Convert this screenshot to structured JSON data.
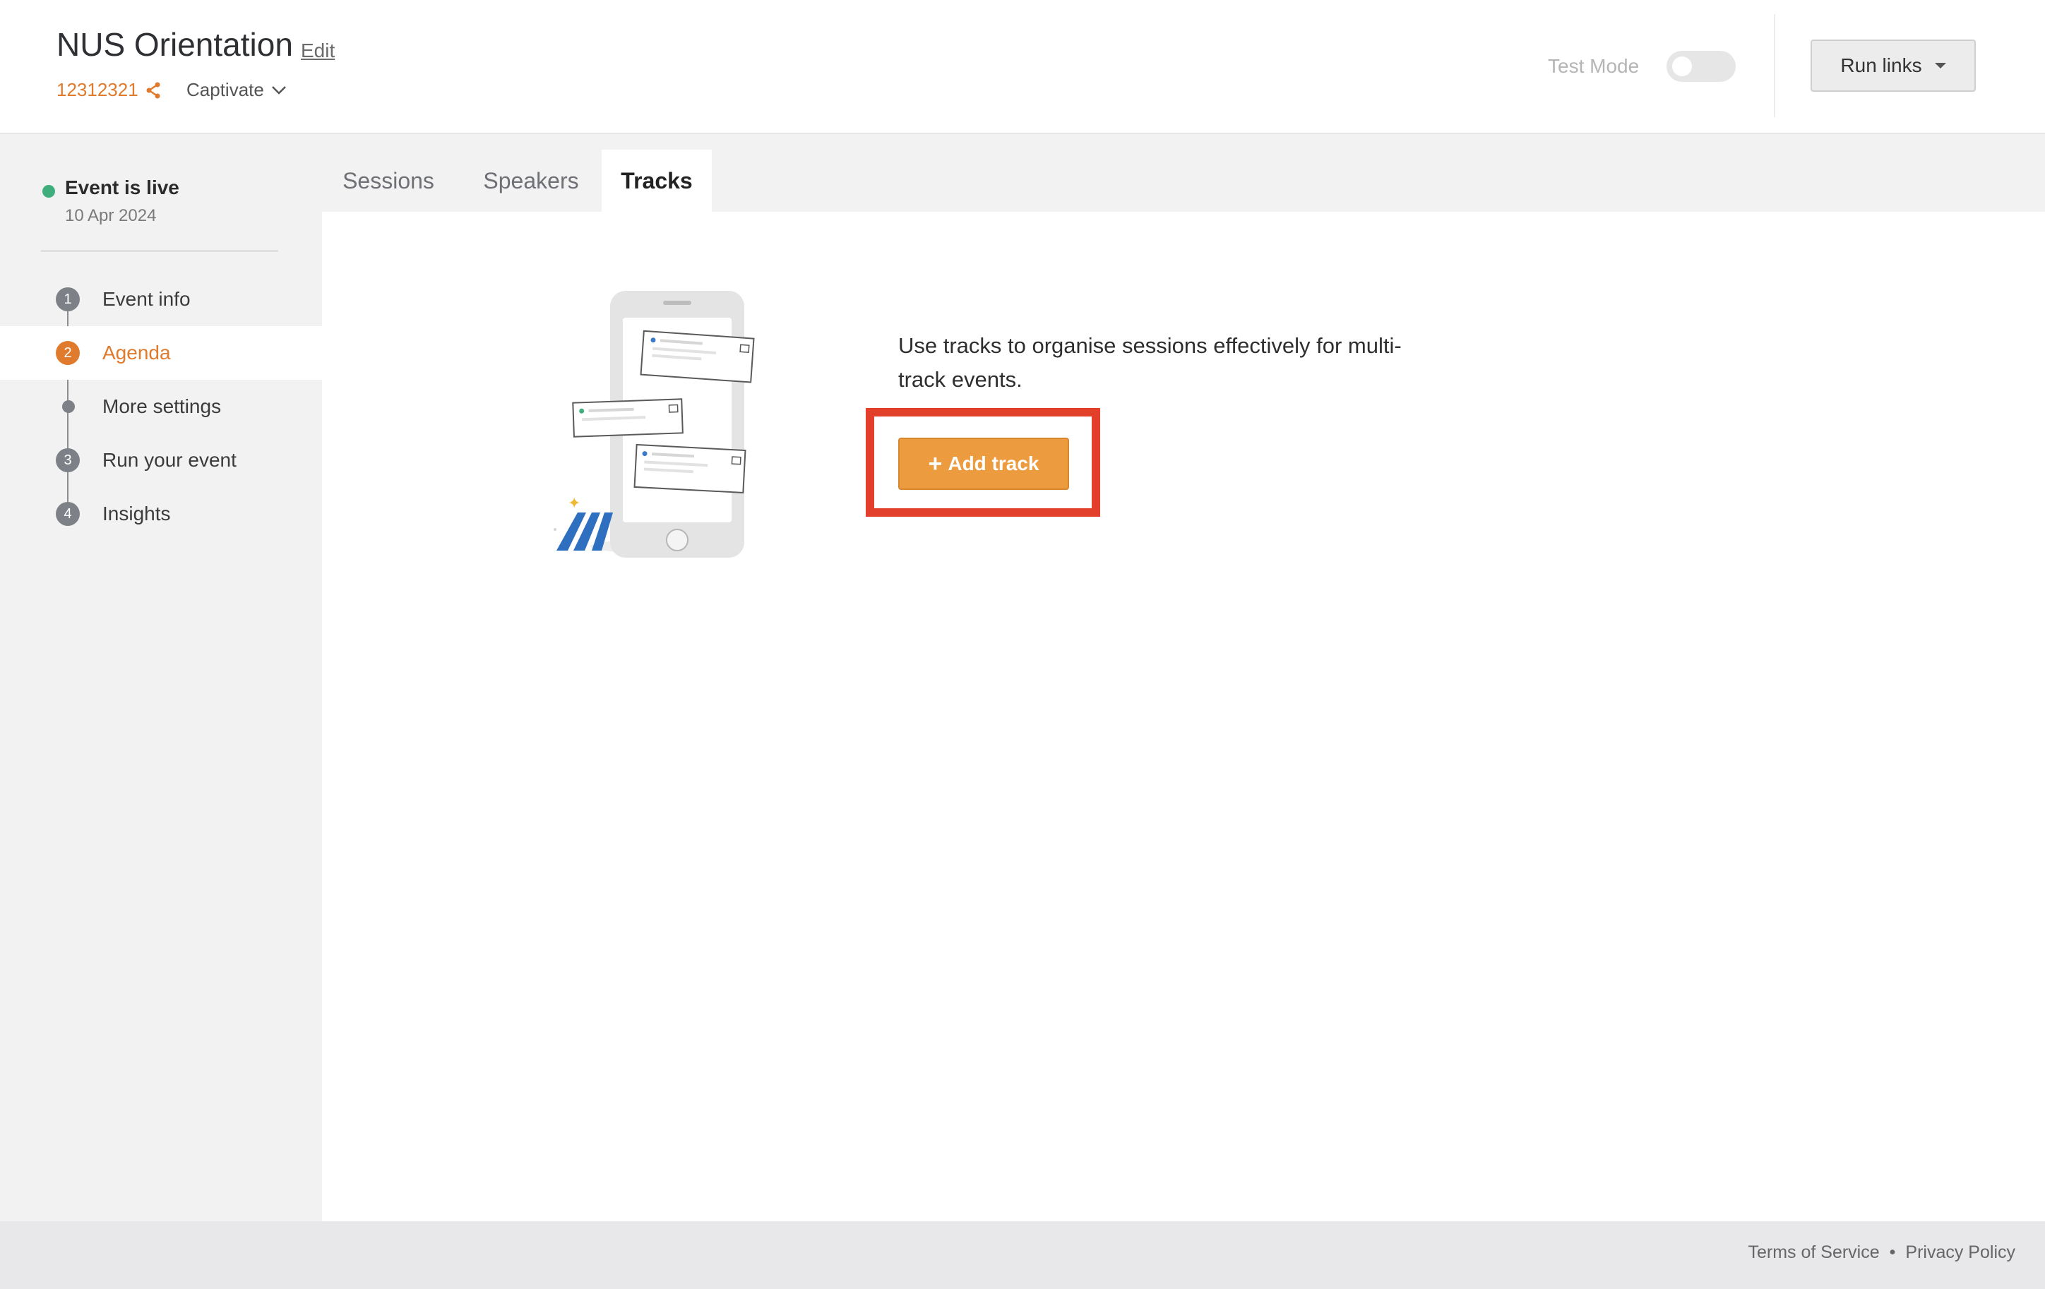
{
  "header": {
    "event_title": "NUS Orientation",
    "edit_label": "Edit",
    "event_code": "12312321",
    "workspace": "Captivate",
    "test_mode_label": "Test Mode",
    "test_mode_on": false,
    "run_links_label": "Run links"
  },
  "sidebar": {
    "status_text": "Event is live",
    "status_date": "10 Apr 2024",
    "items": [
      {
        "step": "1",
        "label": "Event info",
        "active": false
      },
      {
        "step": "2",
        "label": "Agenda",
        "active": true
      },
      {
        "step": "",
        "label": "More settings",
        "active": false
      },
      {
        "step": "3",
        "label": "Run your event",
        "active": false
      },
      {
        "step": "4",
        "label": "Insights",
        "active": false
      }
    ]
  },
  "tabs": [
    {
      "label": "Sessions",
      "active": false
    },
    {
      "label": "Speakers",
      "active": false
    },
    {
      "label": "Tracks",
      "active": true
    }
  ],
  "main": {
    "empty_message": "Use tracks to organise sessions effectively for multi-track events.",
    "add_track_label": "Add track"
  },
  "footer": {
    "terms_label": "Terms of Service",
    "separator": "•",
    "privacy_label": "Privacy Policy"
  },
  "colors": {
    "accent": "#e07a2c",
    "button": "#ed9b3f",
    "live": "#3fae7c",
    "highlight": "#e3402c"
  }
}
